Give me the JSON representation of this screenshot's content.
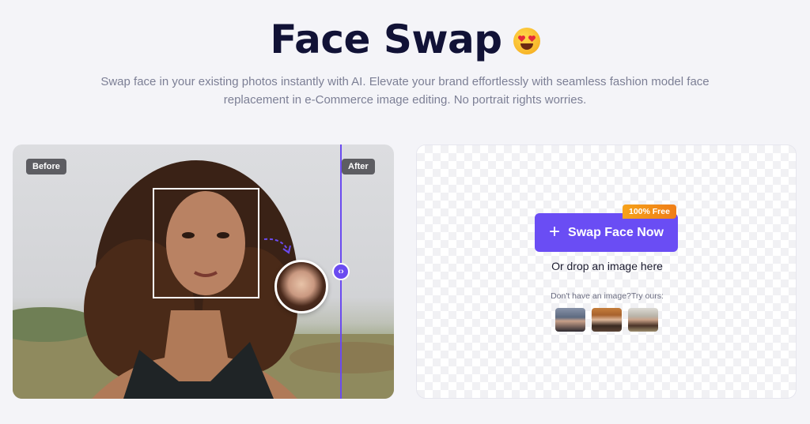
{
  "header": {
    "title": "Face Swap",
    "subtitle_line1": "Swap face in your existing photos instantly with AI. Elevate your brand effortlessly with seamless fashion model face",
    "subtitle_line2": "replacement in e-Commerce image editing. No portrait rights worries."
  },
  "compare": {
    "before_label": "Before",
    "after_label": "After",
    "divider_color": "#6b4bf0"
  },
  "upload": {
    "button_label": "Swap Face Now",
    "badge": "100% Free",
    "drop_text": "Or drop an image here",
    "try_text": "Don't have an image?Try ours:",
    "accent": "#6a4df4",
    "samples": [
      "sample-woman-dark",
      "sample-man",
      "sample-woman-curly"
    ]
  }
}
